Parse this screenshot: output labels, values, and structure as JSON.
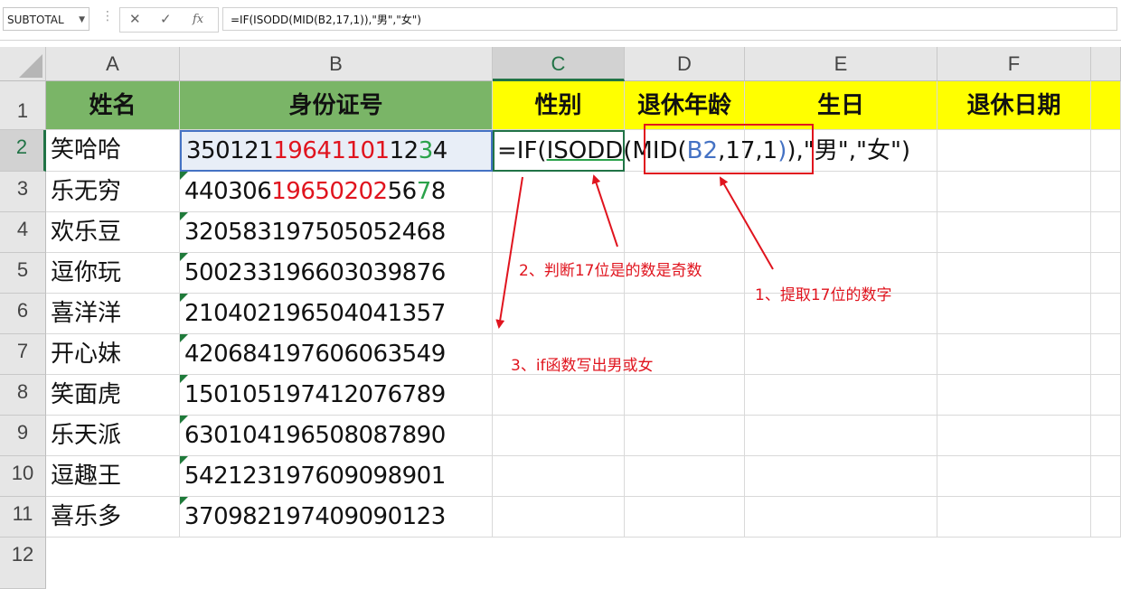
{
  "formula_bar": {
    "name_box": "SUBTOTAL",
    "formula": "=IF(ISODD(MID(B2,17,1)),\"男\",\"女\")",
    "cancel_glyph": "✕",
    "enter_glyph": "✓",
    "fx_label": "fx"
  },
  "columns": [
    "A",
    "B",
    "C",
    "D",
    "E",
    "F"
  ],
  "rows": [
    "1",
    "2",
    "3",
    "4",
    "5",
    "6",
    "7",
    "8",
    "9",
    "10",
    "11",
    "12"
  ],
  "headers": {
    "name": "姓名",
    "id_number": "身份证号",
    "gender": "性别",
    "retire_age": "退休年龄",
    "birthday": "生日",
    "retire_date": "退休日期"
  },
  "data_rows": [
    {
      "name": "笑哈哈",
      "id": "350121196411011234"
    },
    {
      "name": "乐无穷",
      "id": "440306196502025678"
    },
    {
      "name": "欢乐豆",
      "id": "320583197505052468"
    },
    {
      "name": "逗你玩",
      "id": "500233196603039876"
    },
    {
      "name": "喜洋洋",
      "id": "210402196504041357"
    },
    {
      "name": "开心妹",
      "id": "420684197606063549"
    },
    {
      "name": "笑面虎",
      "id": "150105197412076789"
    },
    {
      "name": "乐天派",
      "id": "630104196508087890"
    },
    {
      "name": "逗趣王",
      "id": "542123197609098901"
    },
    {
      "name": "喜乐多",
      "id": "370982197409090123"
    }
  ],
  "id_highlight": {
    "row2": {
      "pre": "350121",
      "birth": "19641101",
      "mid": "12",
      "digit17": "3",
      "last": "4"
    },
    "row3": {
      "pre": "440306",
      "birth": "19650202",
      "mid": "56",
      "digit17": "7",
      "last": "8"
    }
  },
  "cell_formula": {
    "p1": "=IF(",
    "p2": "ISODD",
    "p3": "(",
    "p4": "MID(",
    "p5": "B2",
    "p6": ",17,1",
    "p7": ")",
    "p8": ")",
    "p9": ",\"男\",\"女\")"
  },
  "annotations": {
    "step1": "1、提取17位的数字",
    "step2": "2、判断17位是的数是奇数",
    "step3": "3、if函数写出男或女"
  },
  "colors": {
    "header_green": "#7ab567",
    "header_yellow": "#ffff00",
    "highlight_red": "#e0141e",
    "highlight_green": "#2aa24a",
    "ref_blue": "#4472c4",
    "excel_green": "#217346"
  }
}
